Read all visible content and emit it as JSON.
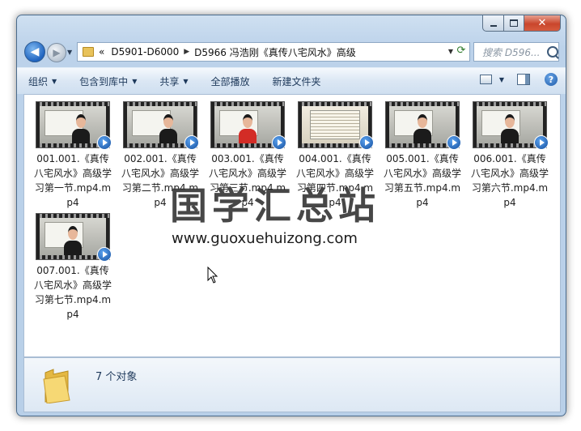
{
  "window": {
    "caption": {
      "minimize": "—",
      "maximize": "□",
      "close": "✕"
    }
  },
  "address": {
    "crumbs": [
      "D5901-D6000",
      "D5966 冯浩刚《真传八宅风水》高级"
    ],
    "overflow": "«"
  },
  "search": {
    "placeholder": "搜索 D596..."
  },
  "toolbar": {
    "items": [
      "组织",
      "包含到库中",
      "共享",
      "全部播放",
      "新建文件夹"
    ]
  },
  "files": [
    {
      "label": "001.001.《真传八宅风水》高级学习第一节.mp4.mp4",
      "thumb": "board"
    },
    {
      "label": "002.001.《真传八宅风水》高级学习第二节.mp4.mp4",
      "thumb": "board"
    },
    {
      "label": "003.001.《真传八宅风水》高级学习第三节.mp4.mp4",
      "thumb": "red"
    },
    {
      "label": "004.001.《真传八宅风水》高级学习第四节.mp4.mp4",
      "thumb": "doc"
    },
    {
      "label": "005.001.《真传八宅风水》高级学习第五节.mp4.mp4",
      "thumb": "black"
    },
    {
      "label": "006.001.《真传八宅风水》高级学习第六节.mp4.mp4",
      "thumb": "black"
    },
    {
      "label": "007.001.《真传八宅风水》高级学习第七节.mp4.mp4",
      "thumb": "black"
    }
  ],
  "watermark": {
    "title": "国学汇总站",
    "url": "www.guoxuehuizong.com"
  },
  "details": {
    "count": "7 个对象"
  },
  "colors": {
    "accent": "#1e395b",
    "window_frame": "#4a6b8c",
    "close": "#c9462c"
  }
}
